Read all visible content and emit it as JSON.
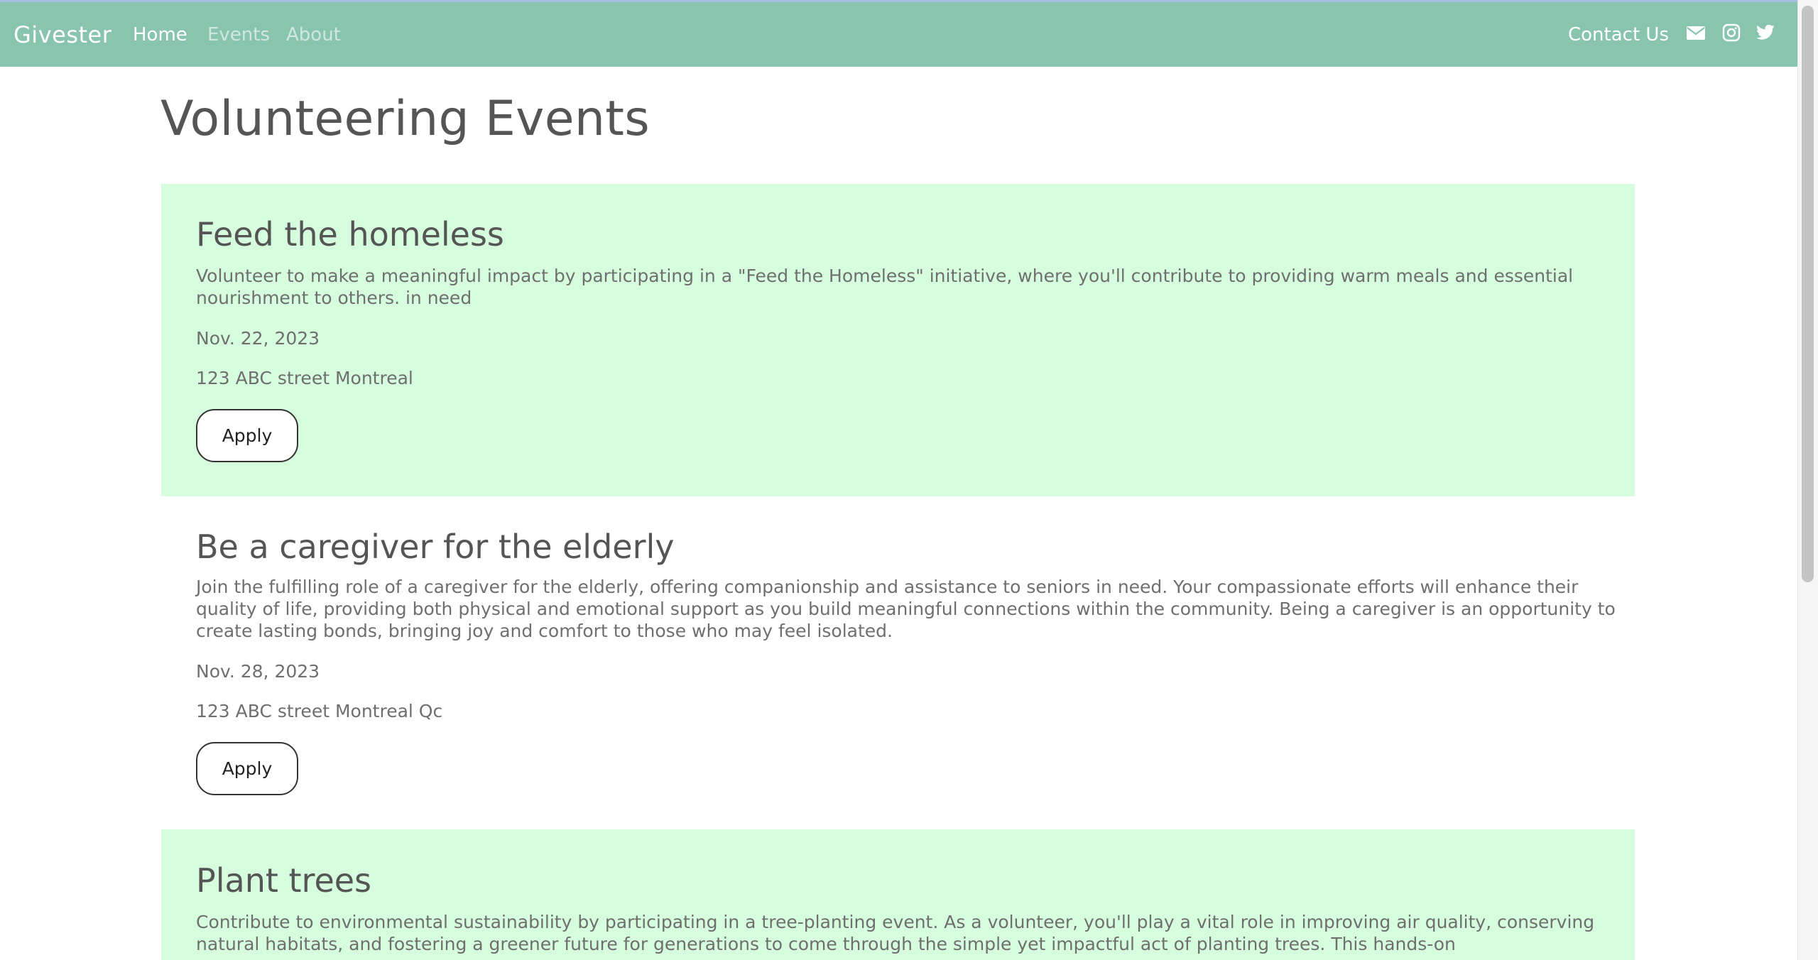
{
  "navbar": {
    "brand": "Givester",
    "links": [
      {
        "label": "Home",
        "active": true
      },
      {
        "label": "Events",
        "active": false
      },
      {
        "label": "About",
        "active": false
      }
    ],
    "contact_label": "Contact Us",
    "social_icons": [
      "mail-icon",
      "instagram-icon",
      "twitter-icon"
    ],
    "color": "#89c4af"
  },
  "main": {
    "title": "Volunteering Events",
    "card_tint": "#d6fddd",
    "events": [
      {
        "title": "Feed the homeless",
        "description": "Volunteer to make a meaningful impact by participating in a \"Feed the Homeless\" initiative, where you'll contribute to providing warm meals and essential nourishment to others. in need",
        "date": "Nov. 22, 2023",
        "location": "123 ABC street Montreal",
        "button_label": "Apply"
      },
      {
        "title": "Be a caregiver for the elderly",
        "description": "Join the fulfilling role of a caregiver for the elderly, offering companionship and assistance to seniors in need. Your compassionate efforts will enhance their quality of life, providing both physical and emotional support as you build meaningful connections within the community. Being a caregiver is an opportunity to create lasting bonds, bringing joy and comfort to those who may feel isolated.",
        "date": "Nov. 28, 2023",
        "location": "123 ABC street Montreal Qc",
        "button_label": "Apply"
      },
      {
        "title": "Plant trees",
        "description": "Contribute to environmental sustainability by participating in a tree-planting event. As a volunteer, you'll play a vital role in improving air quality, conserving natural habitats, and fostering a greener future for generations to come through the simple yet impactful act of planting trees. This hands-on"
      }
    ]
  }
}
